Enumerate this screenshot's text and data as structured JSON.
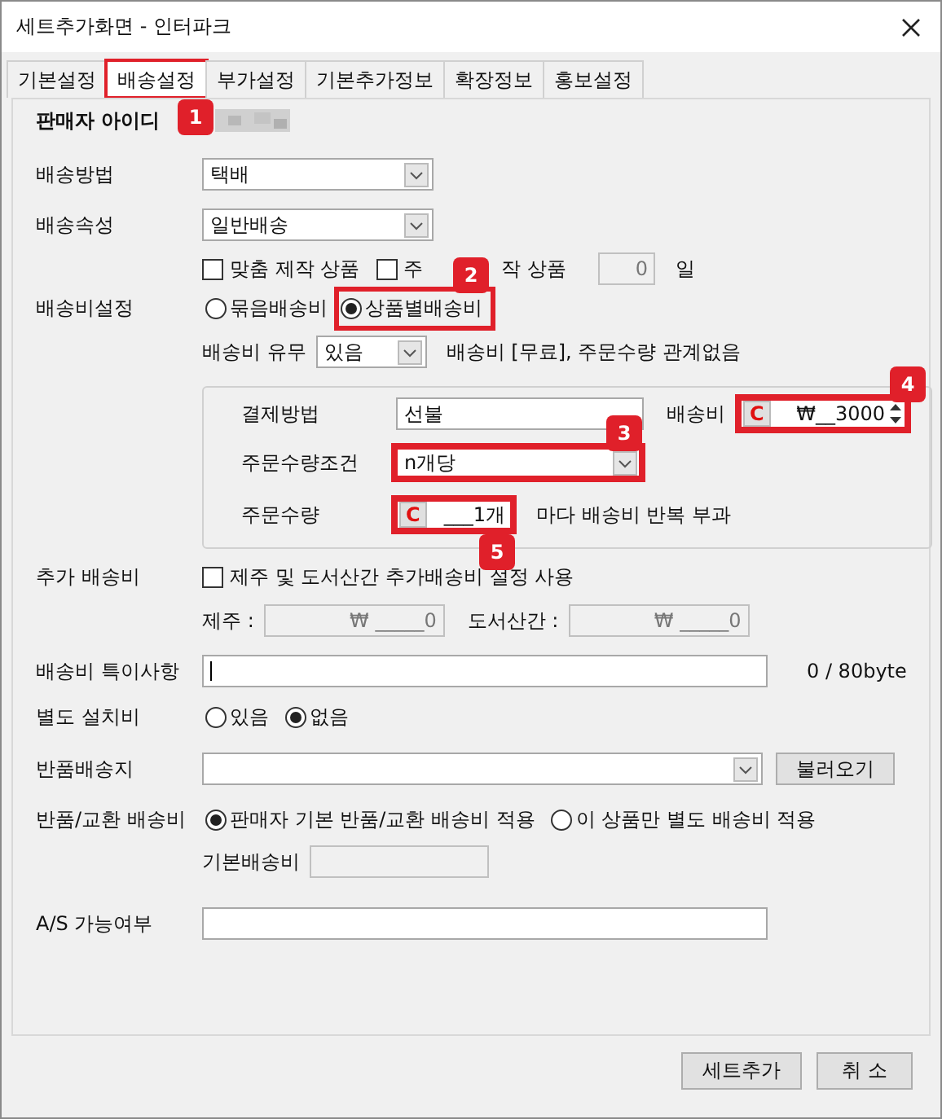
{
  "window": {
    "title": "세트추가화면 - 인터파크"
  },
  "tabs": [
    {
      "label": "기본설정",
      "selected": false,
      "highlighted": false
    },
    {
      "label": "배송설정",
      "selected": true,
      "highlighted": true
    },
    {
      "label": "부가설정",
      "selected": false,
      "highlighted": false
    },
    {
      "label": "기본추가정보",
      "selected": false,
      "highlighted": false
    },
    {
      "label": "확장정보",
      "selected": false,
      "highlighted": false
    },
    {
      "label": "홍보설정",
      "selected": false,
      "highlighted": false
    }
  ],
  "seller_id": {
    "label": "판매자 아이디"
  },
  "shipping_method": {
    "label": "배송방법",
    "value": "택배"
  },
  "shipping_type": {
    "label": "배송속성",
    "value": "일반배송"
  },
  "made_options": [
    {
      "label": "맞춤 제작 상품",
      "checked": false
    },
    {
      "label": "주",
      "label_tail": "작 상품",
      "checked": false
    }
  ],
  "production_days": {
    "value": "0",
    "unit": "일"
  },
  "fee_setting": {
    "label": "배송비설정",
    "options": [
      {
        "label": "묶음배송비",
        "selected": false,
        "highlighted": false
      },
      {
        "label": "상품별배송비",
        "selected": true,
        "highlighted": true
      }
    ]
  },
  "fee_presence": {
    "label": "배송비 유무",
    "value": "있음",
    "note": "배송비 [무료], 주문수량 관계없음"
  },
  "group": {
    "payment": {
      "label": "결제방법",
      "value": "선불"
    },
    "fee": {
      "label": "배송비",
      "prefix": "C",
      "value": "₩__3000",
      "highlighted": true
    },
    "condition": {
      "label": "주문수량조건",
      "value": "n개당",
      "highlighted": true
    },
    "quantity": {
      "label": "주문수량",
      "prefix": "C",
      "value": "___1개",
      "note": "마다 배송비 반복 부과",
      "highlighted": true
    }
  },
  "extra_fee": {
    "label": "추가 배송비",
    "checkbox": {
      "label": "제주 및 도서산간 추가배송비 설정 사용",
      "checked": false
    },
    "jeju": {
      "label": "제주 :",
      "value": "₩ _____0"
    },
    "island": {
      "label": "도서산간 :",
      "value": "₩ _____0"
    }
  },
  "fee_notes": {
    "label": "배송비 특이사항",
    "counter": "0 / 80byte"
  },
  "install_fee": {
    "label": "별도 설치비",
    "options": [
      {
        "label": "있음",
        "selected": false
      },
      {
        "label": "없음",
        "selected": true
      }
    ]
  },
  "return_address": {
    "label": "반품배송지",
    "button": "불러오기"
  },
  "return_fee": {
    "label": "반품/교환 배송비",
    "options": [
      {
        "label": "판매자 기본 반품/교환 배송비 적용",
        "selected": true
      },
      {
        "label": "이 상품만 별도 배송비 적용",
        "selected": false
      }
    ],
    "base_label": "기본배송비"
  },
  "as_field": {
    "label": "A/S 가능여부"
  },
  "buttons": [
    "세트추가",
    "취 소"
  ],
  "badges": [
    "1",
    "2",
    "3",
    "4",
    "5"
  ]
}
